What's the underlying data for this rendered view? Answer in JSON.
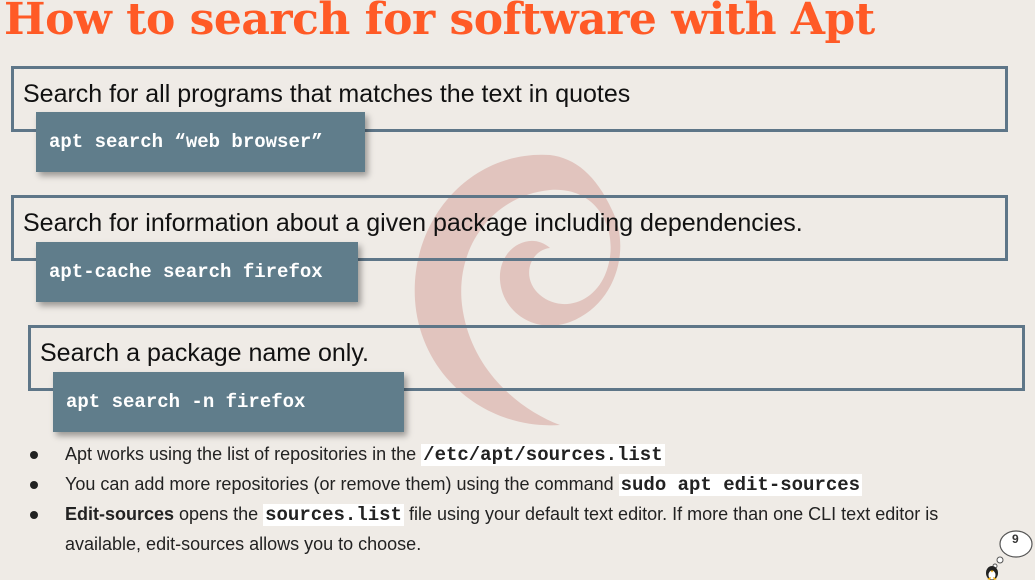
{
  "title": "How to search for software with Apt",
  "sections": [
    {
      "description": "Search for all programs that matches the text in quotes",
      "command": "apt search “web browser”"
    },
    {
      "description": "Search for information about a given package including dependencies.",
      "command": "apt-cache search firefox"
    },
    {
      "description": "Search a package name only.",
      "command": "apt search -n firefox"
    }
  ],
  "bullets": [
    {
      "text_before": "Apt works using the list of repositories in the ",
      "code": "/etc/apt/sources.list"
    },
    {
      "text_before": "You can add more repositories (or remove them) using the command ",
      "code": "sudo apt edit-sources"
    },
    {
      "bold": "Edit-sources",
      "text_before": " opens the ",
      "code": "sources.list",
      "text_after": " file using your default text editor. If more than one CLI text editor is available, edit-sources allows you to choose."
    }
  ],
  "page_number": "9",
  "colors": {
    "title": "#ff5a26",
    "box_border": "#5e7688",
    "command_bg": "#607d8b",
    "background": "#efebe6",
    "swirl": "#dcb7b0"
  },
  "icons": [
    "debian-swirl-watermark",
    "tux-penguin-icon",
    "thought-bubble-icon"
  ]
}
